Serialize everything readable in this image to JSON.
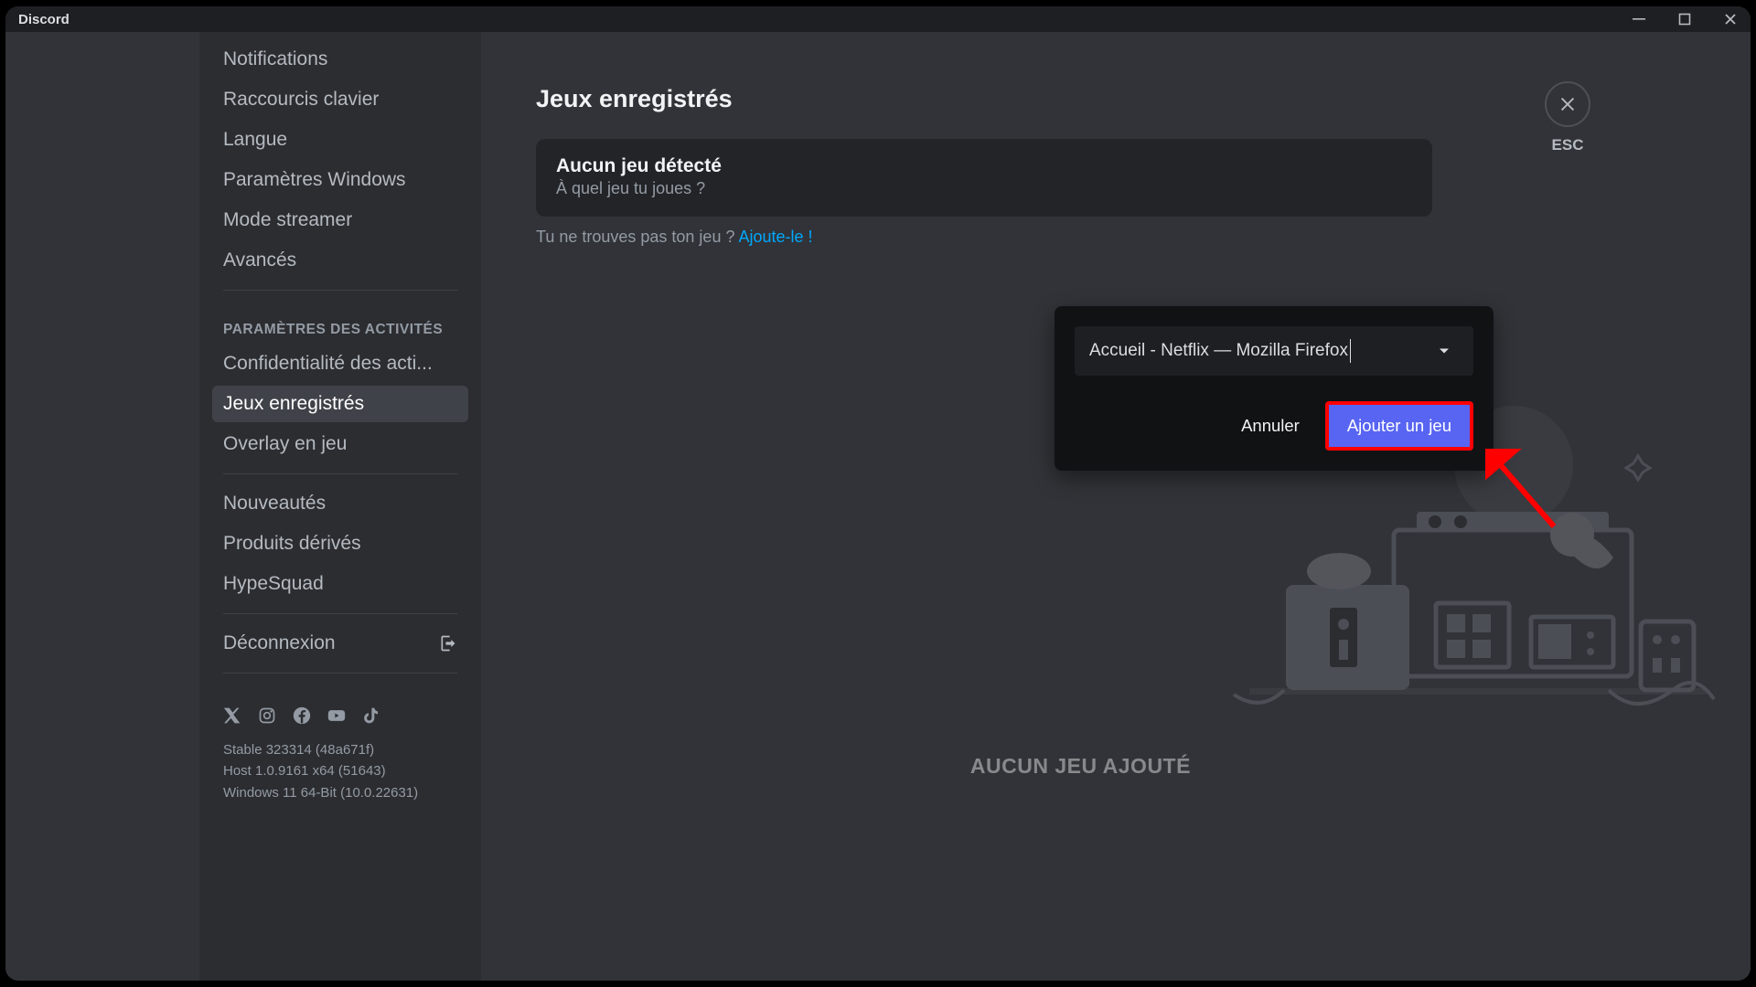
{
  "app_title": "Discord",
  "window_controls": {
    "minimize": "minimize-icon",
    "maximize": "maximize-icon",
    "close": "close-icon"
  },
  "sidebar": {
    "top_items": [
      "Notifications",
      "Raccourcis clavier",
      "Langue",
      "Paramètres Windows",
      "Mode streamer",
      "Avancés"
    ],
    "activities_header": "PARAMÈTRES DES ACTIVITÉS",
    "activities_items": [
      "Confidentialité des acti...",
      "Jeux enregistrés",
      "Overlay en jeu"
    ],
    "activities_active_index": 1,
    "bottom_items": [
      "Nouveautés",
      "Produits dérivés",
      "HypeSquad"
    ],
    "logout_label": "Déconnexion",
    "version": {
      "l1": "Stable 323314 (48a671f)",
      "l2": "Host 1.0.9161 x64 (51643)",
      "l3": "Windows 11 64-Bit (10.0.22631)"
    }
  },
  "main": {
    "title": "Jeux enregistrés",
    "no_game_title": "Aucun jeu détecté",
    "no_game_sub": "À quel jeu tu joues ?",
    "help_text": "Tu ne trouves pas ton jeu ? ",
    "help_link": "Ajoute-le !",
    "empty_state": "AUCUN JEU AJOUTÉ"
  },
  "esc": {
    "label": "ESC"
  },
  "popover": {
    "selected_app": "Accueil - Netflix — Mozilla Firefox",
    "cancel_label": "Annuler",
    "add_label": "Ajouter un jeu"
  },
  "social_icons": [
    "x-icon",
    "instagram-icon",
    "facebook-icon",
    "youtube-icon",
    "tiktok-icon"
  ]
}
